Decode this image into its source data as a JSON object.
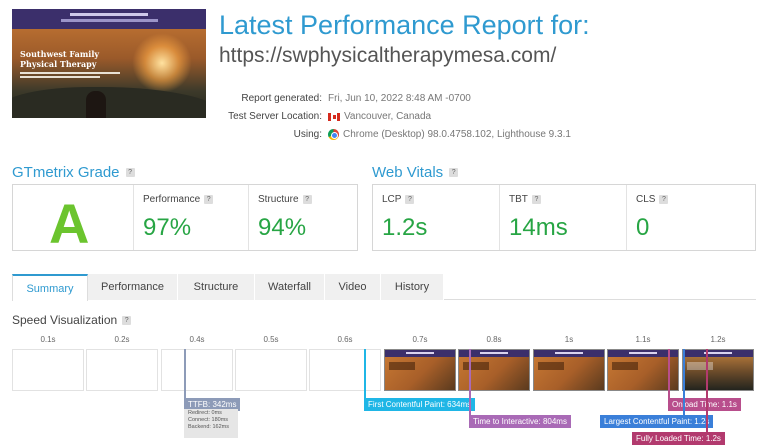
{
  "header": {
    "title": "Latest Performance Report for:",
    "url": "https://swphysicaltherapymesa.com/",
    "thumbnail": {
      "headline": "Southwest Family\nPhysical Therapy"
    }
  },
  "meta": [
    {
      "label": "Report generated:",
      "value": "Fri, Jun 10, 2022 8:48 AM -0700",
      "icon": ""
    },
    {
      "label": "Test Server Location:",
      "value": "Vancouver, Canada",
      "icon": "canada-flag-icon"
    },
    {
      "label": "Using:",
      "value": "Chrome (Desktop) 98.0.4758.102, Lighthouse 9.3.1",
      "icon": "chrome-icon"
    }
  ],
  "gtmetrix": {
    "title": "GTmetrix Grade",
    "grade": "A",
    "performance": {
      "label": "Performance",
      "value": "97%"
    },
    "structure": {
      "label": "Structure",
      "value": "94%"
    }
  },
  "web_vitals": {
    "title": "Web Vitals",
    "lcp": {
      "label": "LCP",
      "value": "1.2s"
    },
    "tbt": {
      "label": "TBT",
      "value": "14ms"
    },
    "cls": {
      "label": "CLS",
      "value": "0"
    }
  },
  "tabs": [
    "Summary",
    "Performance",
    "Structure",
    "Waterfall",
    "Video",
    "History"
  ],
  "active_tab": "Summary",
  "speed": {
    "title": "Speed Visualization",
    "ticks": [
      "0.1s",
      "0.2s",
      "0.4s",
      "0.5s",
      "0.6s",
      "0.7s",
      "0.8s",
      "1s",
      "1.1s",
      "1.2s"
    ],
    "markers": {
      "ttfb": "TTFB: 342ms",
      "ttfb_redirect": "Redirect: 0ms",
      "ttfb_connect": "Connect: 180ms",
      "ttfb_backend": "Backend: 162ms",
      "fcp": "First Contentful Paint: 634ms",
      "tti": "Time to Interactive: 804ms",
      "lcp": "Largest Contentful Paint: 1.2s",
      "onload": "Onload Time: 1.1s",
      "fully_loaded": "Fully Loaded Time: 1.2s"
    }
  },
  "colors": {
    "accent": "#2f9ad0",
    "grade": "#6bc42e",
    "good": "#27a544",
    "ttfb": "#8d9bb8",
    "fcp": "#1fb6e6",
    "tti": "#a96ab6",
    "lcp": "#3a7fd9",
    "onload": "#b84e8c",
    "fully_loaded": "#b23a6e"
  }
}
